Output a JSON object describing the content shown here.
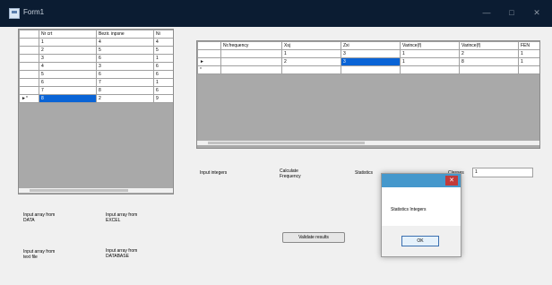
{
  "window": {
    "title": "Form1",
    "minimize_glyph": "—",
    "maximize_glyph": "□",
    "close_glyph": "✕"
  },
  "left_grid": {
    "columns": [
      "Nr crt",
      "Bezir. inpsne",
      "Ni"
    ],
    "rows": [
      {
        "marker": "",
        "cells": [
          "1",
          "4",
          "4"
        ]
      },
      {
        "marker": "",
        "cells": [
          "2",
          "5",
          "5"
        ]
      },
      {
        "marker": "",
        "cells": [
          "3",
          "6",
          "1"
        ]
      },
      {
        "marker": "",
        "cells": [
          "4",
          "3",
          "6"
        ]
      },
      {
        "marker": "",
        "cells": [
          "5",
          "6",
          "6"
        ]
      },
      {
        "marker": "",
        "cells": [
          "6",
          "7",
          "1"
        ]
      },
      {
        "marker": "",
        "cells": [
          "7",
          "8",
          "6"
        ]
      },
      {
        "marker": "►*",
        "cells": [
          "8",
          "2",
          "9"
        ]
      }
    ]
  },
  "right_grid": {
    "columns": [
      "Nr.frequency",
      "Xsj",
      "Zxi",
      "Varince(f)",
      "Varince(f)",
      "FEN"
    ],
    "rows": [
      {
        "marker": "",
        "cells": [
          "",
          "1",
          "3",
          "1",
          "2",
          "1"
        ]
      },
      {
        "marker": "►",
        "cells": [
          "",
          "2",
          "3",
          "1",
          "8",
          "1"
        ]
      },
      {
        "marker": "*",
        "cells": [
          "",
          "",
          "",
          "",
          "",
          ""
        ]
      }
    ]
  },
  "buttons": {
    "input_array_data": "Input array from DATA",
    "input_array_excel": "Input array from EXCEL",
    "input_array_textfile": "Input array from text file",
    "input_array_database": "Input array from DATABASE",
    "input_integers": "Input integers",
    "calculate_frequency": "Calculate Frequency",
    "statistics": "Statistics",
    "validate_results": "Validate results"
  },
  "fields": {
    "label": "Classes",
    "value": "1"
  },
  "dialog": {
    "message": "Statistics Integers",
    "ok_label": "OK",
    "close_glyph": "✕"
  },
  "colors": {
    "titlebar": "#0b1c32",
    "selection": "#0a64d6",
    "dialog_title": "#4598cc"
  }
}
